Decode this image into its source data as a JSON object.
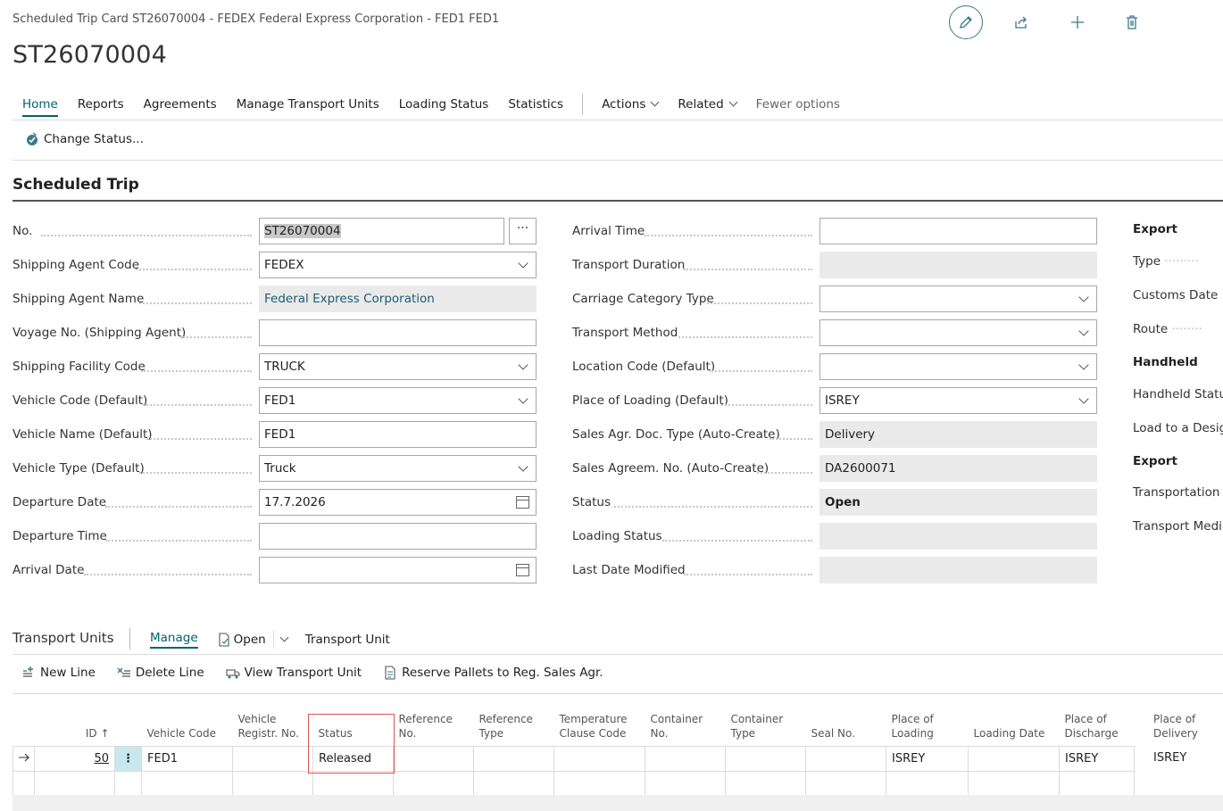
{
  "window_title": "Scheduled Trip Card ST26070004 - FEDEX Federal Express Corporation - FED1 FED1",
  "page_title": "ST26070004",
  "top_icons": [
    "edit-icon",
    "share-icon",
    "add-icon",
    "delete-icon"
  ],
  "action_bar": {
    "items": [
      "Home",
      "Reports",
      "Agreements",
      "Manage Transport Units",
      "Loading Status",
      "Statistics"
    ],
    "actions": "Actions",
    "related": "Related",
    "fewer": "Fewer options"
  },
  "change_status": "Change Status...",
  "section_title": "Scheduled Trip",
  "left_fields": [
    {
      "label": "No.",
      "value": "ST26070004"
    },
    {
      "label": "Shipping Agent Code",
      "value": "FEDEX"
    },
    {
      "label": "Shipping Agent Name",
      "value": "Federal Express Corporation"
    },
    {
      "label": "Voyage No. (Shipping Agent)",
      "value": ""
    },
    {
      "label": "Shipping Facility Code",
      "value": "TRUCK"
    },
    {
      "label": "Vehicle Code (Default)",
      "value": "FED1"
    },
    {
      "label": "Vehicle Name (Default)",
      "value": "FED1"
    },
    {
      "label": "Vehicle Type (Default)",
      "value": "Truck"
    },
    {
      "label": "Departure Date",
      "value": "17.7.2026"
    },
    {
      "label": "Departure Time",
      "value": ""
    },
    {
      "label": "Arrival Date",
      "value": ""
    }
  ],
  "mid_fields": [
    {
      "label": "Arrival Time",
      "value": ""
    },
    {
      "label": "Transport Duration",
      "value": ""
    },
    {
      "label": "Carriage Category Type",
      "value": ""
    },
    {
      "label": "Transport Method",
      "value": ""
    },
    {
      "label": "Location Code (Default)",
      "value": ""
    },
    {
      "label": "Place of Loading (Default)",
      "value": "ISREY"
    },
    {
      "label": "Sales Agr. Doc. Type (Auto-Create)",
      "value": "Delivery"
    },
    {
      "label": "Sales Agreem. No. (Auto-Create)",
      "value": "DA2600071"
    },
    {
      "label": "Status",
      "value": "Open"
    },
    {
      "label": "Loading Status",
      "value": ""
    },
    {
      "label": "Last Date Modified",
      "value": ""
    }
  ],
  "right_column": {
    "export1": "Export",
    "type": "Type",
    "customs_date": "Customs Date",
    "route": "Route",
    "handheld": "Handheld",
    "handheld_status": "Handheld Status",
    "load_to": "Load to a Design",
    "export2": "Export",
    "transportation": "Transportation C",
    "transport_medium": "Transport Mediu"
  },
  "transport_units": {
    "title": "Transport Units",
    "manage": "Manage",
    "open": "Open",
    "transport_unit": "Transport Unit",
    "toolbar": {
      "new_line": "New Line",
      "delete_line": "Delete Line",
      "view_transport_unit": "View Transport Unit",
      "reserve": "Reserve Pallets to Reg. Sales Agr."
    },
    "columns": [
      "ID ↑",
      "Vehicle Code",
      "Vehicle Registr. No.",
      "Status",
      "Reference No.",
      "Reference Type",
      "Temperature Clause Code",
      "Container No.",
      "Container Type",
      "Seal No.",
      "Place of Loading",
      "Loading Date",
      "Place of Discharge",
      "Place of Delivery"
    ],
    "rows": [
      {
        "id": "50",
        "vehicle_code": "FED1",
        "vehicle_registr": "",
        "status": "Released",
        "reference_no": "",
        "reference_type": "",
        "temperature": "",
        "container_no": "",
        "container_type": "",
        "seal_no": "",
        "place_of_loading": "ISREY",
        "loading_date": "",
        "place_of_discharge": "ISREY",
        "place_of_delivery": "ISREY"
      }
    ]
  },
  "colors": {
    "accent": "#00646f",
    "highlight_box": "#d9534f"
  }
}
